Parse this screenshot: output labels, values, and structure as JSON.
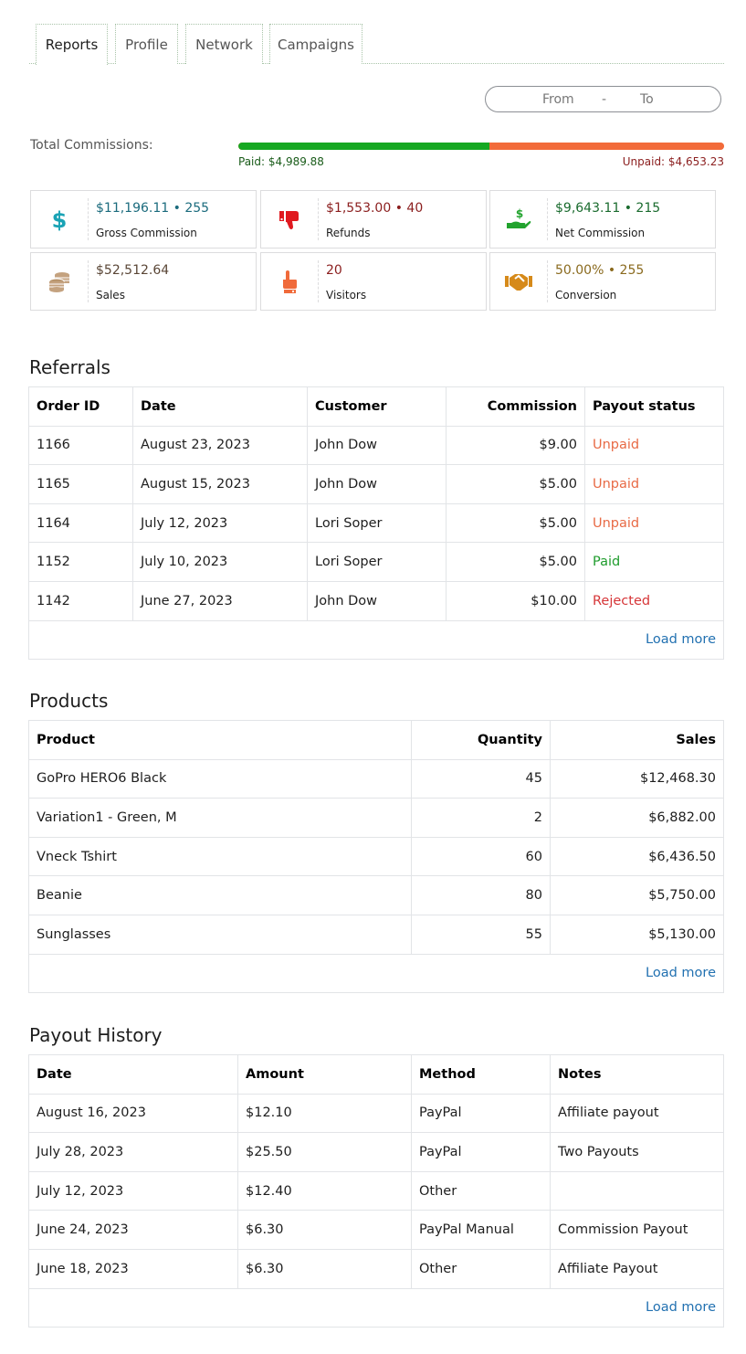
{
  "tabs": [
    {
      "label": "Reports",
      "active": true
    },
    {
      "label": "Profile",
      "active": false
    },
    {
      "label": "Network",
      "active": false
    },
    {
      "label": "Campaigns",
      "active": false
    }
  ],
  "date_range": {
    "from_placeholder": "From",
    "separator": "-",
    "to_placeholder": "To"
  },
  "commissions": {
    "label": "Total Commissions:",
    "paid_label": "Paid: $4,989.88",
    "unpaid_label": "Unpaid: $4,653.23",
    "paid_fraction": 0.5175,
    "colors": {
      "paid": "#16a822",
      "unpaid": "#f26b3a"
    }
  },
  "stats": [
    {
      "value": "$11,196.11 • 255",
      "label": "Gross Commission",
      "icon": "dollar-icon",
      "color": "#1b6b7d",
      "icon_color": "#1aa3b5"
    },
    {
      "value": "$1,553.00 • 40",
      "label": "Refunds",
      "icon": "thumbs-down-icon",
      "color": "#8b1e1e",
      "icon_color": "#e0191f"
    },
    {
      "value": "$9,643.11 • 215",
      "label": "Net Commission",
      "icon": "hand-money-icon",
      "color": "#1a6b2e",
      "icon_color": "#22a32e"
    },
    {
      "value": "$52,512.64",
      "label": "Sales",
      "icon": "coins-icon",
      "color": "#5a4636",
      "icon_color": "#c4a27f"
    },
    {
      "value": "20",
      "label": "Visitors",
      "icon": "pointing-hand-icon",
      "color": "#8b1e1e",
      "icon_color": "#f06a3a"
    },
    {
      "value": "50.00% • 255",
      "label": "Conversion",
      "icon": "handshake-icon",
      "color": "#8a6a1e",
      "icon_color": "#d68a1a"
    }
  ],
  "referrals": {
    "title": "Referrals",
    "columns": [
      "Order ID",
      "Date",
      "Customer",
      "Commission",
      "Payout status"
    ],
    "rows": [
      {
        "order_id": "1166",
        "date": "August 23, 2023",
        "customer": "John Dow",
        "commission": "$9.00",
        "status": "Unpaid"
      },
      {
        "order_id": "1165",
        "date": "August 15, 2023",
        "customer": "John Dow",
        "commission": "$5.00",
        "status": "Unpaid"
      },
      {
        "order_id": "1164",
        "date": "July 12, 2023",
        "customer": "Lori Soper",
        "commission": "$5.00",
        "status": "Unpaid"
      },
      {
        "order_id": "1152",
        "date": "July 10, 2023",
        "customer": "Lori Soper",
        "commission": "$5.00",
        "status": "Paid"
      },
      {
        "order_id": "1142",
        "date": "June 27, 2023",
        "customer": "John Dow",
        "commission": "$10.00",
        "status": "Rejected"
      }
    ],
    "load_more": "Load more"
  },
  "products": {
    "title": "Products",
    "columns": [
      "Product",
      "Quantity",
      "Sales"
    ],
    "rows": [
      {
        "product": "GoPro HERO6 Black",
        "quantity": "45",
        "sales": "$12,468.30"
      },
      {
        "product": "Variation1 - Green, M",
        "quantity": "2",
        "sales": "$6,882.00"
      },
      {
        "product": "Vneck Tshirt",
        "quantity": "60",
        "sales": "$6,436.50"
      },
      {
        "product": "Beanie",
        "quantity": "80",
        "sales": "$5,750.00"
      },
      {
        "product": "Sunglasses",
        "quantity": "55",
        "sales": "$5,130.00"
      }
    ],
    "load_more": "Load more"
  },
  "payouts": {
    "title": "Payout History",
    "columns": [
      "Date",
      "Amount",
      "Method",
      "Notes"
    ],
    "rows": [
      {
        "date": "August 16, 2023",
        "amount": "$12.10",
        "method": "PayPal",
        "notes": "Affiliate payout"
      },
      {
        "date": "July 28, 2023",
        "amount": "$25.50",
        "method": "PayPal",
        "notes": "Two Payouts"
      },
      {
        "date": "July 12, 2023",
        "amount": "$12.40",
        "method": "Other",
        "notes": ""
      },
      {
        "date": "June 24, 2023",
        "amount": "$6.30",
        "method": "PayPal Manual",
        "notes": "Commission Payout"
      },
      {
        "date": "June 18, 2023",
        "amount": "$6.30",
        "method": "Other",
        "notes": "Affiliate Payout"
      }
    ],
    "load_more": "Load more"
  }
}
